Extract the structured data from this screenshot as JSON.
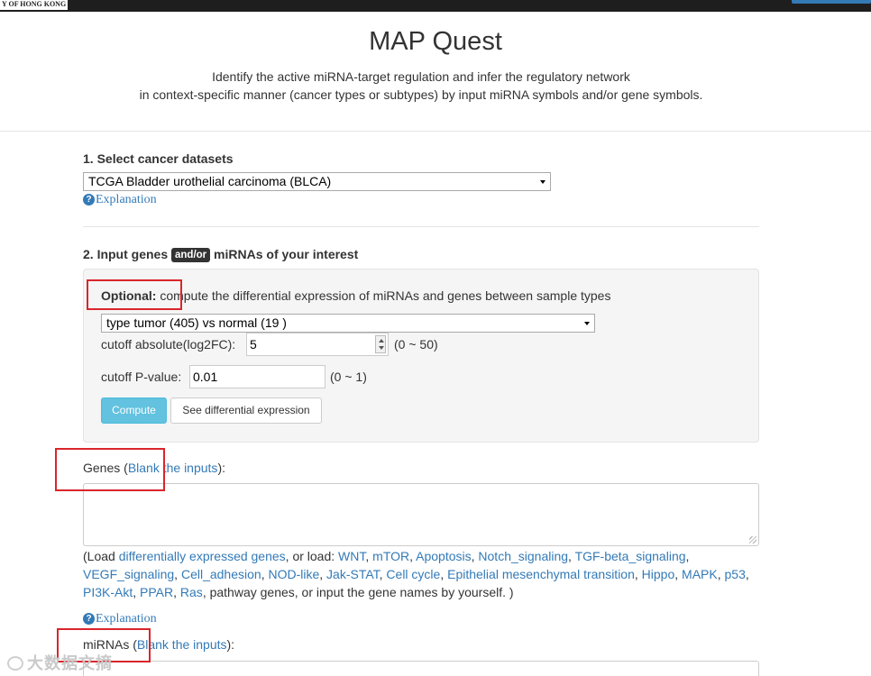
{
  "topbar": {
    "logo_text": "Y OF HONG KONG"
  },
  "header": {
    "title": "MAP Quest",
    "subtitle_line1": "Identify the active miRNA-target regulation and infer the regulatory network",
    "subtitle_line2": "in context-specific manner (cancer types or subtypes) by input miRNA symbols and/or gene symbols."
  },
  "step1": {
    "label": "1. Select cancer datasets",
    "dataset_selected": "TCGA Bladder urothelial carcinoma (BLCA)",
    "explanation": "Explanation"
  },
  "step2": {
    "label_pre": "2. Input genes",
    "tag": "and/or",
    "label_post": "miRNAs of your interest",
    "optional_bold": "Optional:",
    "optional_text": " compute the differential expression of miRNAs and genes between sample types",
    "sample_type_selected": "type tumor (405) vs normal (19 )",
    "cutoff_fc_label": "cutoff absolute(log2FC):",
    "cutoff_fc_value": "5",
    "cutoff_fc_range": "(0 ~ 50)",
    "cutoff_p_label": "cutoff P-value:",
    "cutoff_p_value": "0.01",
    "cutoff_p_range": "(0 ~ 1)",
    "compute_button": "Compute",
    "see_button": "See differential expression"
  },
  "genes": {
    "label": "Genes (",
    "blank_link": "Blank the inputs",
    "label_end": "):",
    "load_open": "(Load ",
    "de_genes_link": "differentially expressed genes",
    "or_load": ", or load: ",
    "pathways": [
      "WNT",
      "mTOR",
      "Apoptosis",
      "Notch_signaling",
      "TGF-beta_signaling",
      "VEGF_signaling",
      "Cell_adhesion",
      "NOD-like",
      "Jak-STAT",
      "Cell cycle",
      "Epithelial mesenchymal transition",
      "Hippo",
      "MAPK",
      "p53",
      "PI3K-Akt",
      "PPAR",
      "Ras"
    ],
    "load_close": ", pathway genes, or input the gene names by yourself. )",
    "explanation": "Explanation"
  },
  "mirnas": {
    "label": "miRNAs (",
    "blank_link": "Blank the inputs",
    "label_end": "):"
  },
  "watermark": "大数据文摘",
  "colors": {
    "link": "#337ab7",
    "info_button": "#5bc0de",
    "annotation_box": "#d9262b"
  }
}
